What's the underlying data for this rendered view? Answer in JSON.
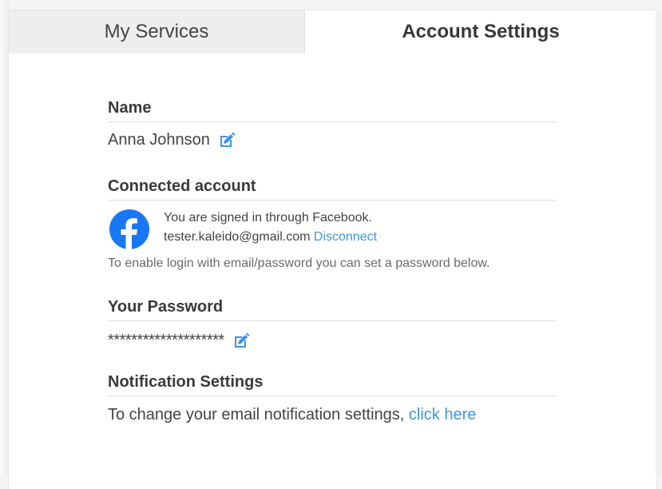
{
  "tabs": [
    {
      "label": "My Services",
      "active": false
    },
    {
      "label": "Account Settings",
      "active": true
    }
  ],
  "sections": {
    "name": {
      "title": "Name",
      "value": "Anna Johnson",
      "edit_icon": "edit-icon"
    },
    "connected_account": {
      "title": "Connected account",
      "provider_icon": "facebook-icon",
      "signed_in_text": "You are signed in through Facebook.",
      "email": "tester.kaleido@gmail.com",
      "disconnect_label": "Disconnect",
      "hint": "To enable login with email/password you can set a password below."
    },
    "password": {
      "title": "Your Password",
      "masked_value": "********************",
      "edit_icon": "edit-icon"
    },
    "notifications": {
      "title": "Notification Settings",
      "text": "To change your email notification settings,",
      "link_label": "click here"
    }
  },
  "colors": {
    "accent": "#3e94e4",
    "facebook": "#1877f2",
    "tab_inactive_bg": "#edeef0"
  }
}
